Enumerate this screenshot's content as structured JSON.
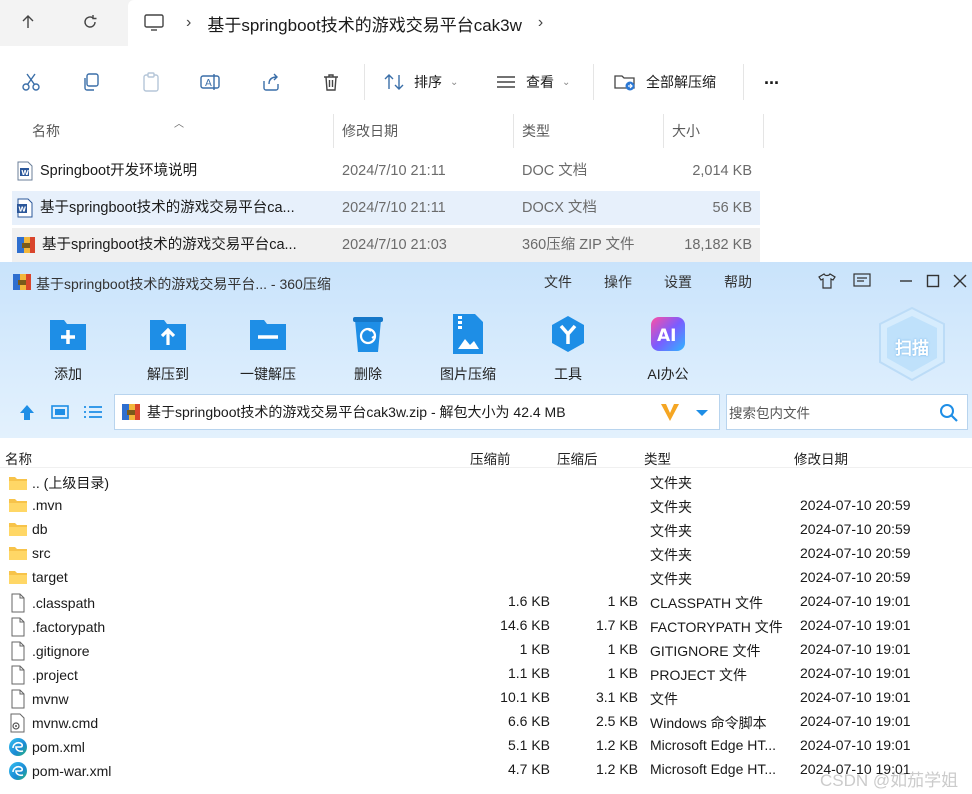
{
  "explorer": {
    "breadcrumb": "基于springboot技术的游戏交易平台cak3w",
    "toolbar": {
      "sort_label": "排序",
      "view_label": "查看",
      "extract_all_label": "全部解压缩",
      "more_label": "..."
    },
    "columns": [
      "名称",
      "修改日期",
      "类型",
      "大小"
    ],
    "files": [
      {
        "name": "Springboot开发环境说明",
        "date": "2024/7/10 21:11",
        "type": "DOC 文档",
        "size": "2,014 KB",
        "icon": "word-doc-icon"
      },
      {
        "name": "基于springboot技术的游戏交易平台ca...",
        "date": "2024/7/10 21:11",
        "type": "DOCX 文档",
        "size": "56 KB",
        "icon": "word-doc-icon"
      },
      {
        "name": "基于springboot技术的游戏交易平台ca...",
        "date": "2024/7/10 21:03",
        "type": "360压缩 ZIP 文件",
        "size": "18,182 KB",
        "icon": "zip-archive-icon"
      }
    ]
  },
  "zip": {
    "title": "基于springboot技术的游戏交易平台... - 360压缩",
    "menu": [
      "文件",
      "操作",
      "设置",
      "帮助"
    ],
    "tools": [
      {
        "label": "添加",
        "icon": "add-icon"
      },
      {
        "label": "解压到",
        "icon": "extract-to-icon"
      },
      {
        "label": "一键解压",
        "icon": "one-click-extract-icon"
      },
      {
        "label": "删除",
        "icon": "delete-icon"
      },
      {
        "label": "图片压缩",
        "icon": "image-compress-icon"
      },
      {
        "label": "工具",
        "icon": "tools-icon"
      },
      {
        "label": "AI办公",
        "icon": "ai-office-icon"
      }
    ],
    "scan_label": "扫描",
    "path_text": "基于springboot技术的游戏交易平台cak3w.zip - 解包大小为 42.4 MB",
    "search_placeholder": "搜索包内文件",
    "columns": {
      "name": "名称",
      "before": "压缩前",
      "after": "压缩后",
      "type": "类型",
      "date": "修改日期"
    },
    "rows": [
      {
        "name": ".. (上级目录)",
        "before": "",
        "after": "",
        "type": "文件夹",
        "date": "",
        "icon": "folder-icon"
      },
      {
        "name": ".mvn",
        "before": "",
        "after": "",
        "type": "文件夹",
        "date": "2024-07-10 20:59",
        "icon": "folder-icon"
      },
      {
        "name": "db",
        "before": "",
        "after": "",
        "type": "文件夹",
        "date": "2024-07-10 20:59",
        "icon": "folder-icon"
      },
      {
        "name": "src",
        "before": "",
        "after": "",
        "type": "文件夹",
        "date": "2024-07-10 20:59",
        "icon": "folder-icon"
      },
      {
        "name": "target",
        "before": "",
        "after": "",
        "type": "文件夹",
        "date": "2024-07-10 20:59",
        "icon": "folder-icon"
      },
      {
        "name": ".classpath",
        "before": "1.6 KB",
        "after": "1 KB",
        "type": "CLASSPATH 文件",
        "date": "2024-07-10 19:01",
        "icon": "file-icon"
      },
      {
        "name": ".factorypath",
        "before": "14.6 KB",
        "after": "1.7 KB",
        "type": "FACTORYPATH 文件",
        "date": "2024-07-10 19:01",
        "icon": "file-icon"
      },
      {
        "name": ".gitignore",
        "before": "1 KB",
        "after": "1 KB",
        "type": "GITIGNORE 文件",
        "date": "2024-07-10 19:01",
        "icon": "file-icon"
      },
      {
        "name": ".project",
        "before": "1.1 KB",
        "after": "1 KB",
        "type": "PROJECT 文件",
        "date": "2024-07-10 19:01",
        "icon": "file-icon"
      },
      {
        "name": "mvnw",
        "before": "10.1 KB",
        "after": "3.1 KB",
        "type": "文件",
        "date": "2024-07-10 19:01",
        "icon": "file-icon"
      },
      {
        "name": "mvnw.cmd",
        "before": "6.6 KB",
        "after": "2.5 KB",
        "type": "Windows 命令脚本",
        "date": "2024-07-10 19:01",
        "icon": "cmd-script-icon"
      },
      {
        "name": "pom.xml",
        "before": "5.1 KB",
        "after": "1.2 KB",
        "type": "Microsoft Edge HT...",
        "date": "2024-07-10 19:01",
        "icon": "edge-icon"
      },
      {
        "name": "pom-war.xml",
        "before": "4.7 KB",
        "after": "1.2 KB",
        "type": "Microsoft Edge HT...",
        "date": "2024-07-10 19:01",
        "icon": "edge-icon"
      }
    ]
  },
  "watermark": "CSDN @如茄学姐"
}
